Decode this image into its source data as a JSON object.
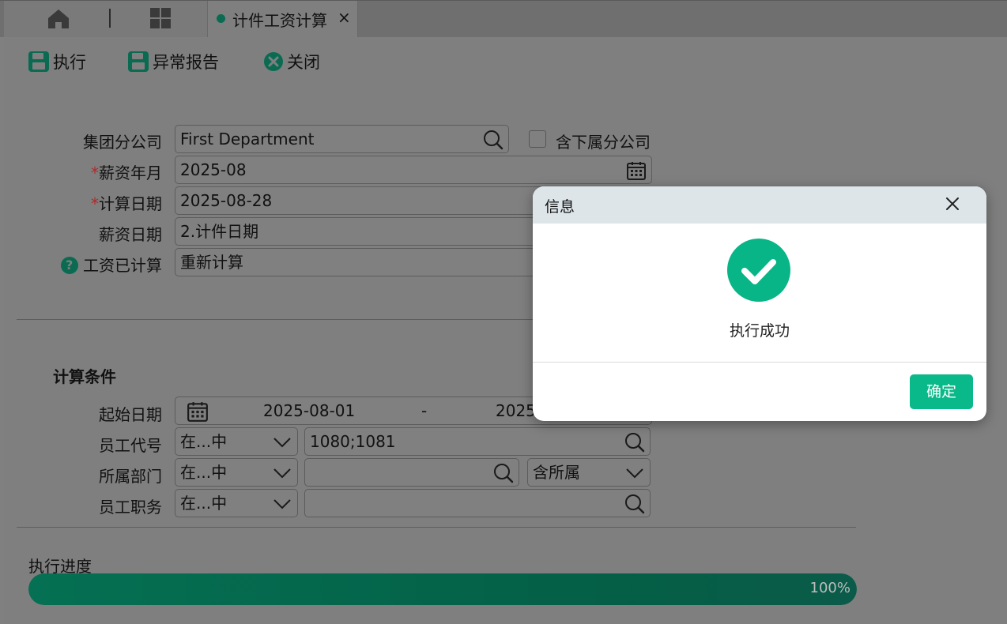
{
  "tabs": {
    "active_label": "计件工资计算",
    "close_symbol": "×"
  },
  "toolbar": {
    "execute_label": "执行",
    "report_label": "异常报告",
    "close_label": "关闭"
  },
  "form": {
    "group_company": {
      "label": "集团分公司",
      "value": "First Department"
    },
    "include_sub": {
      "label": "含下属分公司",
      "checked": false
    },
    "salary_month": {
      "required": "*",
      "label": "薪资年月",
      "value": "2025-08"
    },
    "calc_date": {
      "required": "*",
      "label": "计算日期",
      "value": "2025-08-28"
    },
    "salary_date": {
      "label": "薪资日期",
      "value": "2.计件日期"
    },
    "calculated": {
      "help": "?",
      "label": "工资已计算",
      "value": "重新计算"
    }
  },
  "conditions": {
    "title": "计算条件",
    "start_date": {
      "label": "起始日期",
      "from": "2025-08-01",
      "sep": "-",
      "to": "2025"
    },
    "employee_code": {
      "label": "员工代号",
      "operator": "在...中",
      "value": "1080;1081"
    },
    "department": {
      "label": "所属部门",
      "operator": "在...中",
      "value": "",
      "scope": "含所属"
    },
    "position": {
      "label": "员工职务",
      "operator": "在...中",
      "value": ""
    }
  },
  "progress": {
    "label": "执行进度",
    "percent": 100,
    "text": "100%"
  },
  "dialog": {
    "title": "信息",
    "message": "执行成功",
    "ok_label": "确定"
  },
  "colors": {
    "accent": "#0ab989",
    "progress": "#057053",
    "required": "#b02a2a"
  }
}
